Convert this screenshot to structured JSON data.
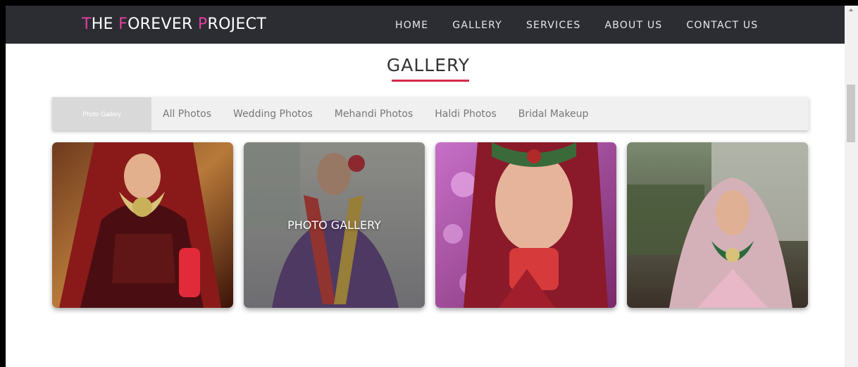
{
  "header": {
    "logo": {
      "parts": [
        "T",
        "HE ",
        "F",
        "OREVER ",
        "P",
        "ROJECT"
      ]
    },
    "nav": [
      "HOME",
      "GALLERY",
      "SERVICES",
      "ABOUT US",
      "CONTACT US"
    ]
  },
  "page": {
    "title": "GALLERY"
  },
  "tabs": {
    "active": "Photo Gallery",
    "items": [
      "All Photos",
      "Wedding Photos",
      "Mehandi Photos",
      "Haldi Photos",
      "Bridal Makeup"
    ]
  },
  "gallery": {
    "hover_caption": "PHOTO GALLERY",
    "photos": [
      "bride-red-lehenga",
      "bride-flower-garland",
      "bride-closeup-makeup",
      "bride-pink-dupatta"
    ]
  },
  "colors": {
    "navbar": "#2b2d33",
    "logo_accent": "#e040a0",
    "heading_underline": "#d8284a",
    "tabs_bg": "#f0f0f0",
    "active_tab_bg": "#d9d9d9"
  }
}
